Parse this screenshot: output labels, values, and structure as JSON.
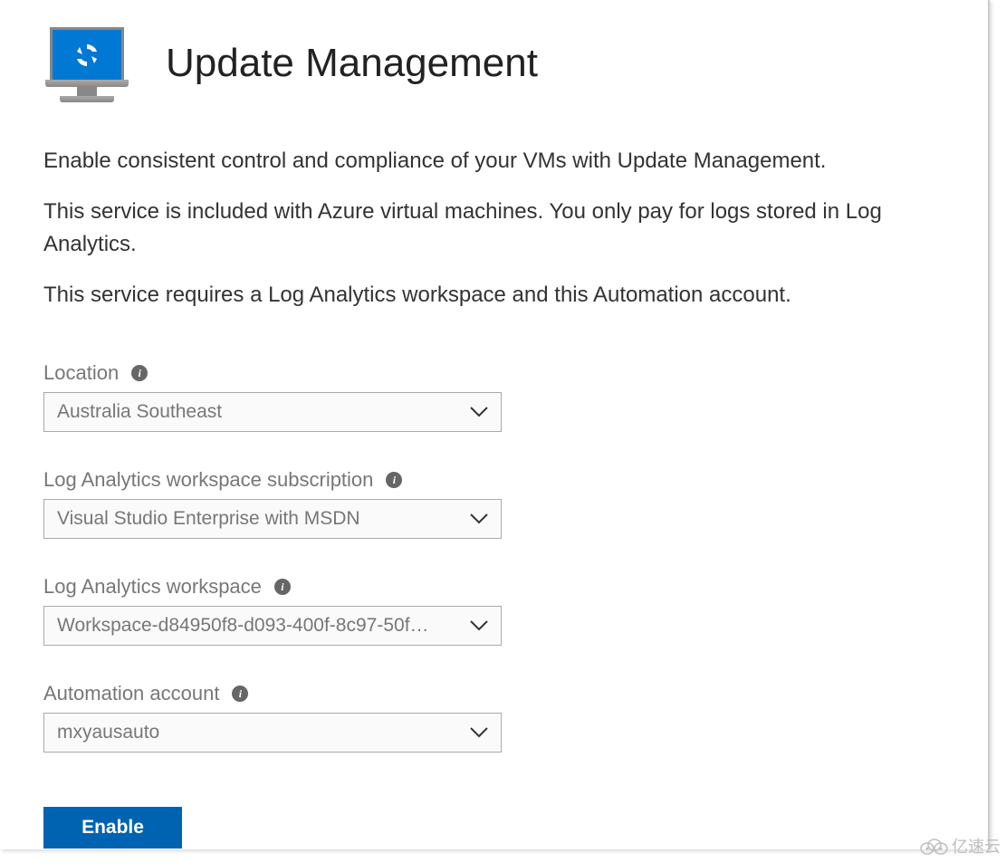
{
  "header": {
    "title": "Update Management"
  },
  "description": {
    "line1": "Enable consistent control and compliance of your VMs with Update Management.",
    "line2": "This service is included with Azure virtual machines. You only pay for logs stored in Log Analytics.",
    "line3": "This service requires a Log Analytics workspace and this Automation account."
  },
  "fields": {
    "location": {
      "label": "Location",
      "value": "Australia Southeast"
    },
    "subscription": {
      "label": "Log Analytics workspace subscription",
      "value": "Visual Studio Enterprise with MSDN"
    },
    "workspace": {
      "label": "Log Analytics workspace",
      "value": "Workspace-d84950f8-d093-400f-8c97-50f…"
    },
    "automation": {
      "label": "Automation account",
      "value": "mxyausauto"
    }
  },
  "buttons": {
    "enable": "Enable"
  },
  "watermark": {
    "text": "亿速云"
  }
}
